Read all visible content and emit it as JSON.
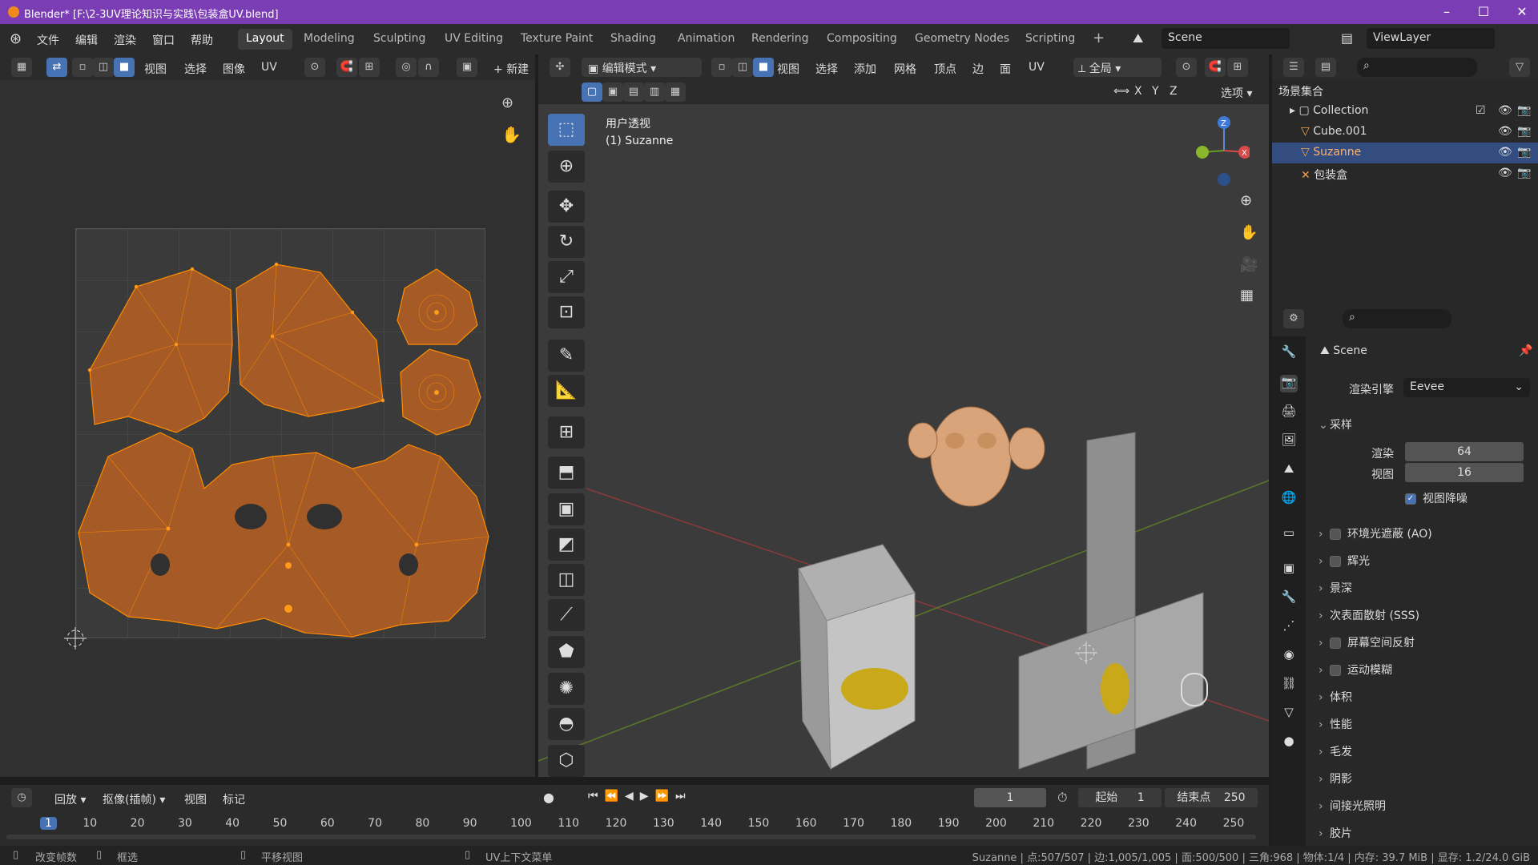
{
  "window": {
    "title": "Blender* [F:\\2-3UV理论知识与实践\\包装盒UV.blend]"
  },
  "menus": [
    "文件",
    "编辑",
    "渲染",
    "窗口",
    "帮助"
  ],
  "workspaces": [
    "Layout",
    "Modeling",
    "Sculpting",
    "UV Editing",
    "Texture Paint",
    "Shading",
    "Animation",
    "Rendering",
    "Compositing",
    "Geometry Nodes",
    "Scripting"
  ],
  "active_workspace": "Layout",
  "scene": "Scene",
  "view_layer": "ViewLayer",
  "uv_header": {
    "items": [
      "视图",
      "选择",
      "图像",
      "UV"
    ],
    "new_label": "新建"
  },
  "vp_header": {
    "mode": "编辑模式",
    "items": [
      "视图",
      "选择",
      "添加",
      "网格",
      "顶点",
      "边",
      "面",
      "UV"
    ],
    "orientation": "全局",
    "options": "选项",
    "axes": [
      "X",
      "Y",
      "Z"
    ]
  },
  "viewport": {
    "view_name": "用户透视",
    "object": "(1) Suzanne"
  },
  "outliner": {
    "root": "场景集合",
    "collection": "Collection",
    "objects": [
      {
        "name": "Cube.001",
        "selected": false
      },
      {
        "name": "Suzanne",
        "selected": true
      },
      {
        "name": "包装盒",
        "selected": false
      }
    ]
  },
  "properties": {
    "title": "Scene",
    "engine_label": "渲染引擎",
    "engine": "Eevee",
    "sampling": {
      "label": "采样",
      "render_label": "渲染",
      "render": "64",
      "viewport_label": "视图",
      "viewport": "16",
      "denoise_label": "视图降噪",
      "denoise": true
    },
    "sections": [
      {
        "label": "环境光遮蔽 (AO)",
        "checkbox": true
      },
      {
        "label": "辉光",
        "checkbox": true
      },
      {
        "label": "景深",
        "checkbox": false
      },
      {
        "label": "次表面散射 (SSS)",
        "checkbox": false
      },
      {
        "label": "屏幕空间反射",
        "checkbox": true
      },
      {
        "label": "运动模糊",
        "checkbox": true
      },
      {
        "label": "体积",
        "checkbox": false
      },
      {
        "label": "性能",
        "checkbox": false
      },
      {
        "label": "毛发",
        "checkbox": false
      },
      {
        "label": "阴影",
        "checkbox": false
      },
      {
        "label": "间接光照明",
        "checkbox": false
      },
      {
        "label": "胶片",
        "checkbox": false
      }
    ]
  },
  "timeline": {
    "playback": "回放",
    "keying": "抠像(插帧)",
    "view": "视图",
    "marker": "标记",
    "current_frame": "1",
    "start_label": "起始",
    "start": "1",
    "end_label": "结束点",
    "end": "250",
    "ticks": [
      "1",
      "10",
      "20",
      "30",
      "40",
      "50",
      "60",
      "70",
      "80",
      "90",
      "100",
      "110",
      "120",
      "130",
      "140",
      "150",
      "160",
      "170",
      "180",
      "190",
      "200",
      "210",
      "220",
      "230",
      "240",
      "250"
    ]
  },
  "status": {
    "left1": "改变帧数",
    "left2": "框选",
    "mid1": "平移视图",
    "mid2": "UV上下文菜单",
    "right": "Suzanne | 点:507/507 | 边:1,005/1,005 | 面:500/500 | 三角:968 | 物体:1/4 | 内存: 39.7 MiB | 显存: 1.2/24.0 GiB"
  },
  "colors": {
    "title_bar": "#7a3db4",
    "accent": "#4772b3",
    "uv_fill": "#a65a25",
    "uv_vertex": "#ff8c00"
  }
}
